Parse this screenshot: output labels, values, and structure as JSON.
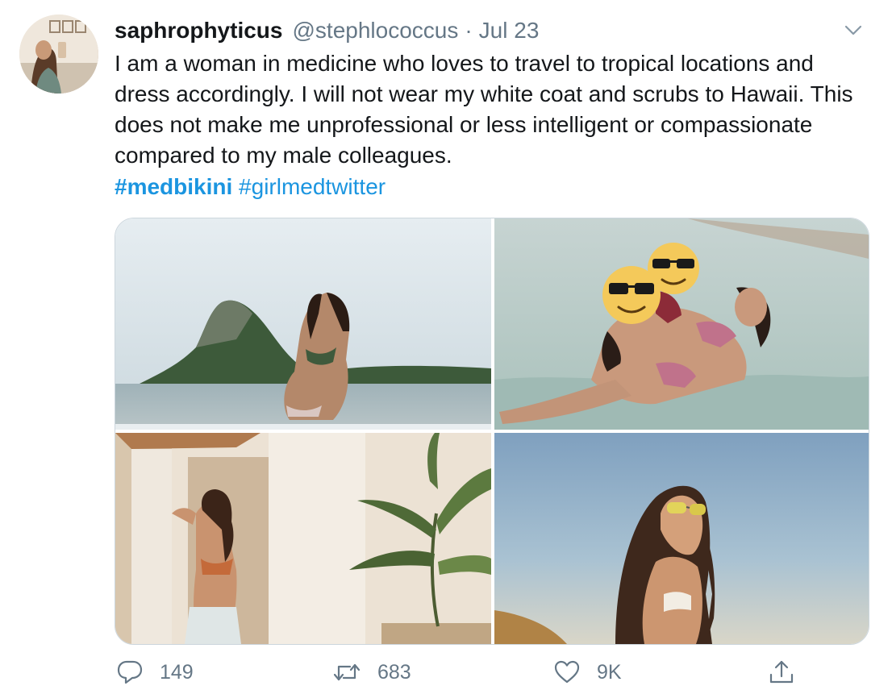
{
  "tweet": {
    "display_name": "saphrophyticus",
    "handle": "@stephlococcus",
    "separator": "·",
    "date": "Jul 23",
    "text": "I am a woman in medicine who loves to travel to tropical locations and dress accordingly. I will not wear my white coat and scrubs to Hawaii. This does not make me unprofessional or less intelligent or compassionate compared to my male colleagues.",
    "hashtags": [
      "#medbikini",
      "#girlmedtwitter"
    ]
  },
  "actions": {
    "reply_count": "149",
    "retweet_count": "683",
    "like_count": "9K"
  },
  "icons": {
    "more": "chevron-down-icon",
    "reply": "speech-bubble-icon",
    "retweet": "retweet-icon",
    "like": "heart-icon",
    "share": "share-upload-icon"
  },
  "colors": {
    "text": "#14171a",
    "muted": "#657786",
    "link": "#1b95e0",
    "border": "#ccd6dd"
  }
}
